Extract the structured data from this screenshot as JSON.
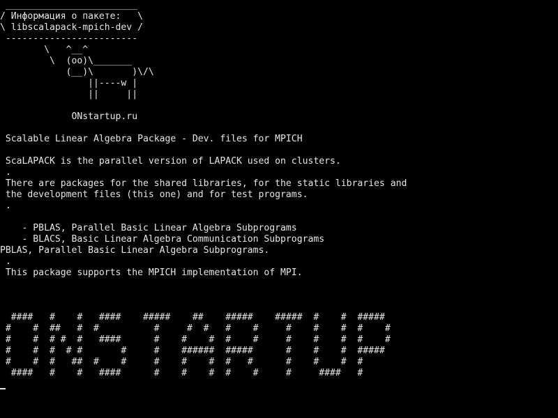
{
  "terminal": {
    "fg_color": "#e6e6e6",
    "bg_color": "#000000",
    "lines": [
      " ________________________",
      "/ Информация о пакете:   \\",
      "\\ libscalapack-mpich-dev /",
      " ------------------------",
      "        \\   ^__^",
      "         \\  (oo)\\_______",
      "            (__)\\       )\\/\\",
      "                ||----w |",
      "                ||     ||",
      "",
      "             ONstartup.ru",
      "",
      " Scalable Linear Algebra Package - Dev. files for MPICH",
      "",
      " ScaLAPACK is the parallel version of LAPACK used on clusters.",
      " .",
      " There are packages for the shared libraries, for the static libraries and",
      " the development files (this one) and for test programs.",
      " .",
      "",
      "    - PBLAS, Parallel Basic Linear Algebra Subprograms",
      "    - BLACS, Basic Linear Algebra Communication Subprograms",
      "PBLAS, Parallel Basic Linear Algebra Subprograms.",
      " .",
      " This package supports the MPICH implementation of MPI.",
      "",
      "",
      "",
      "  ####   #    #   ####    #####    ##    #####    #####  #    #  #####",
      " #    #  ##   #  #          #     #  #   #    #     #    #    #  #    #",
      " #    #  # #  #   ####      #    #    #  #    #     #    #    #  #    #",
      " #    #  #  # #       #     #    ######  #####      #    #    #  #####",
      " #    #  #   ##  #    #     #    #    #  #   #      #    #    #  #",
      "  ####   #    #   ####      #    #    #  #    #     #     ####   #"
    ]
  }
}
